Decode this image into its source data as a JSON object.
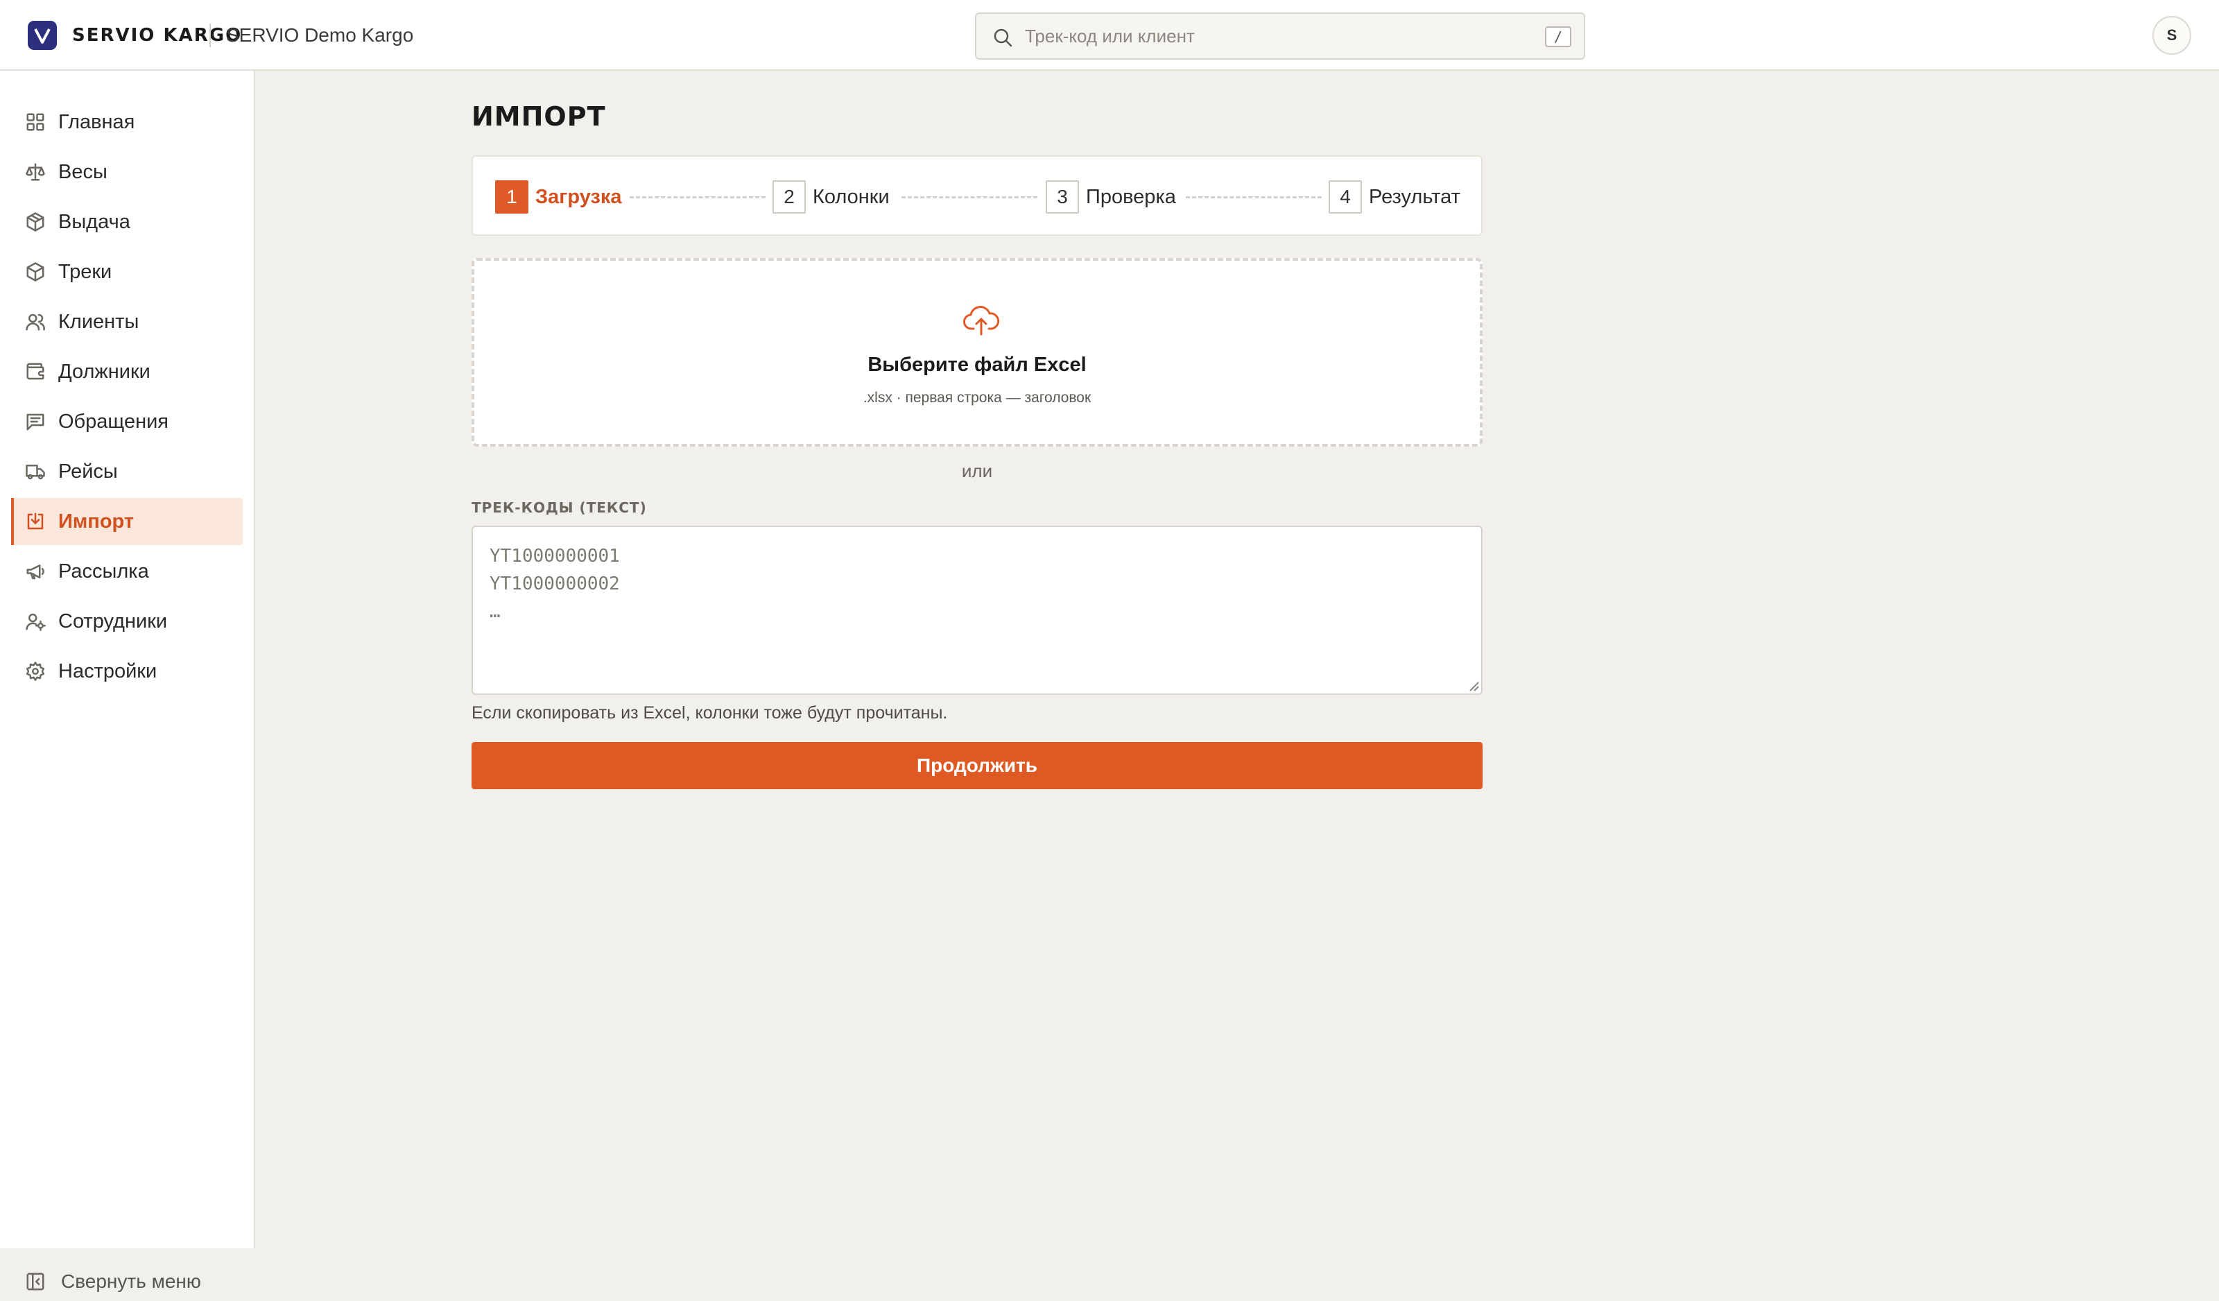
{
  "header": {
    "brand": "SERVIO KARGO",
    "workspace": "SERVIO Demo Kargo",
    "search": {
      "placeholder": "Трек-код или клиент",
      "shortcut": "/"
    },
    "avatar_initial": "S"
  },
  "sidebar": {
    "items": [
      {
        "label": "Главная",
        "icon": "grid-icon"
      },
      {
        "label": "Весы",
        "icon": "scale-icon"
      },
      {
        "label": "Выдача",
        "icon": "box-icon"
      },
      {
        "label": "Треки",
        "icon": "package-icon"
      },
      {
        "label": "Клиенты",
        "icon": "users-icon"
      },
      {
        "label": "Должники",
        "icon": "wallet-icon"
      },
      {
        "label": "Обращения",
        "icon": "message-icon"
      },
      {
        "label": "Рейсы",
        "icon": "truck-icon"
      },
      {
        "label": "Импорт",
        "icon": "import-icon",
        "active": true
      },
      {
        "label": "Рассылка",
        "icon": "megaphone-icon"
      },
      {
        "label": "Сотрудники",
        "icon": "user-cog-icon"
      },
      {
        "label": "Настройки",
        "icon": "gear-icon"
      }
    ],
    "collapse_label": "Свернуть меню"
  },
  "main": {
    "title": "ИМПОРТ",
    "steps": [
      {
        "num": "1",
        "label": "Загрузка",
        "active": true
      },
      {
        "num": "2",
        "label": "Колонки"
      },
      {
        "num": "3",
        "label": "Проверка"
      },
      {
        "num": "4",
        "label": "Результат"
      }
    ],
    "dropzone": {
      "title": "Выберите файл Excel",
      "hint": ".xlsx · первая строка — заголовок"
    },
    "or_text": "или",
    "tracks_label": "ТРЕК-КОДЫ (ТЕКСТ)",
    "tracks_placeholder": "YT1000000001\nYT1000000002\n…",
    "tracks_value": "",
    "paste_hint": "Если скопировать из Excel, колонки тоже будут прочитаны.",
    "continue_label": "Продолжить"
  },
  "colors": {
    "accent": "#e05a27",
    "brand_badge": "#2b2f7d",
    "active_bg": "#fbe6db",
    "page_bg": "#f2f0eb"
  }
}
